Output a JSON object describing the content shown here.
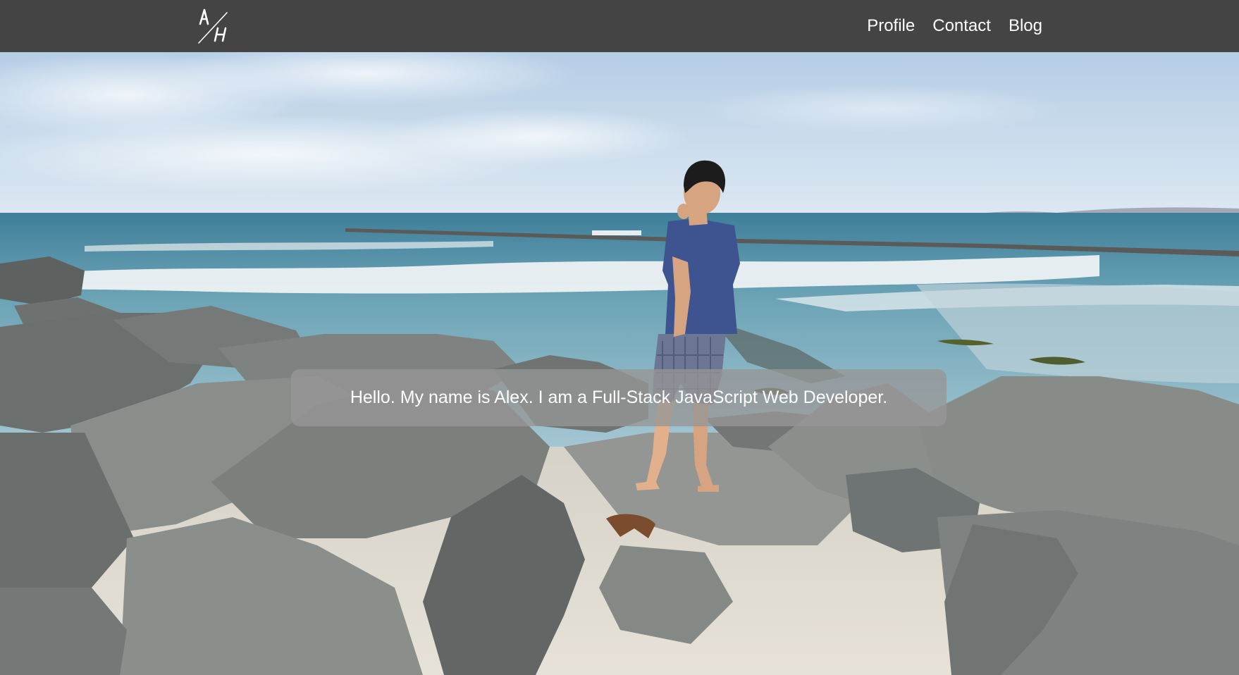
{
  "header": {
    "logo": {
      "text": "A/H",
      "icon": "monogram-logo"
    },
    "nav": [
      {
        "label": "Profile"
      },
      {
        "label": "Contact"
      },
      {
        "label": "Blog"
      }
    ]
  },
  "hero": {
    "image_subject": "man-walking-on-beach-jetty-rocks",
    "intro": "Hello. My name is Alex. I am a Full-Stack JavaScript Web Developer."
  },
  "colors": {
    "navbar_background": "#444444",
    "nav_text": "#ffffff",
    "banner_background": "rgba(150,150,150,0.78)",
    "banner_text": "#ffffff"
  }
}
